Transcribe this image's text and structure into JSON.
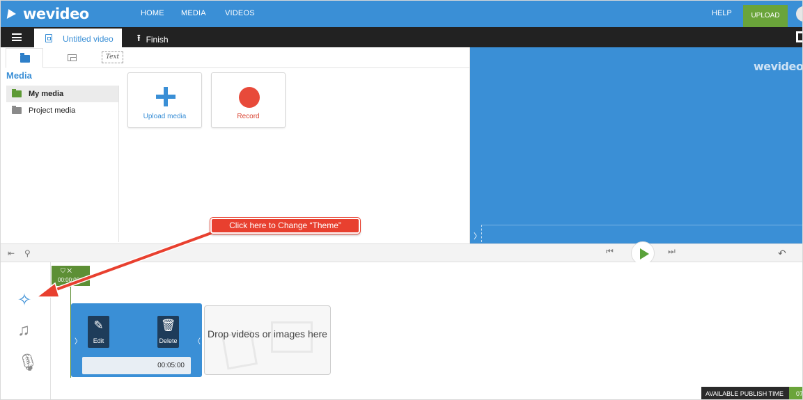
{
  "nav": {
    "logo": "wevideo",
    "links": [
      "HOME",
      "MEDIA",
      "VIDEOS"
    ],
    "help": "HELP",
    "upload": "UPLOAD"
  },
  "toolbar": {
    "project_title": "Untitled video",
    "finish_label": "Finish"
  },
  "media_panel": {
    "text_tab": "Text",
    "title": "Media",
    "folders": [
      "My media",
      "Project media"
    ],
    "cards": [
      "Upload media",
      "Record"
    ]
  },
  "preview": {
    "watermark": "wevideo"
  },
  "timeline": {
    "marker_time": "00:00:00",
    "clip": {
      "edit_label": "Edit",
      "delete_label": "Delete",
      "duration": "00:05:00"
    },
    "drop_text": "Drop videos or images here"
  },
  "publish": {
    "label": "AVAILABLE PUBLISH TIME",
    "value": "07"
  },
  "annotation": {
    "callout": "Click here to Change “Theme”"
  },
  "colors": {
    "brand_blue": "#3a8fd6",
    "upload_green": "#6aa43a",
    "callout_red": "#e8402f"
  }
}
